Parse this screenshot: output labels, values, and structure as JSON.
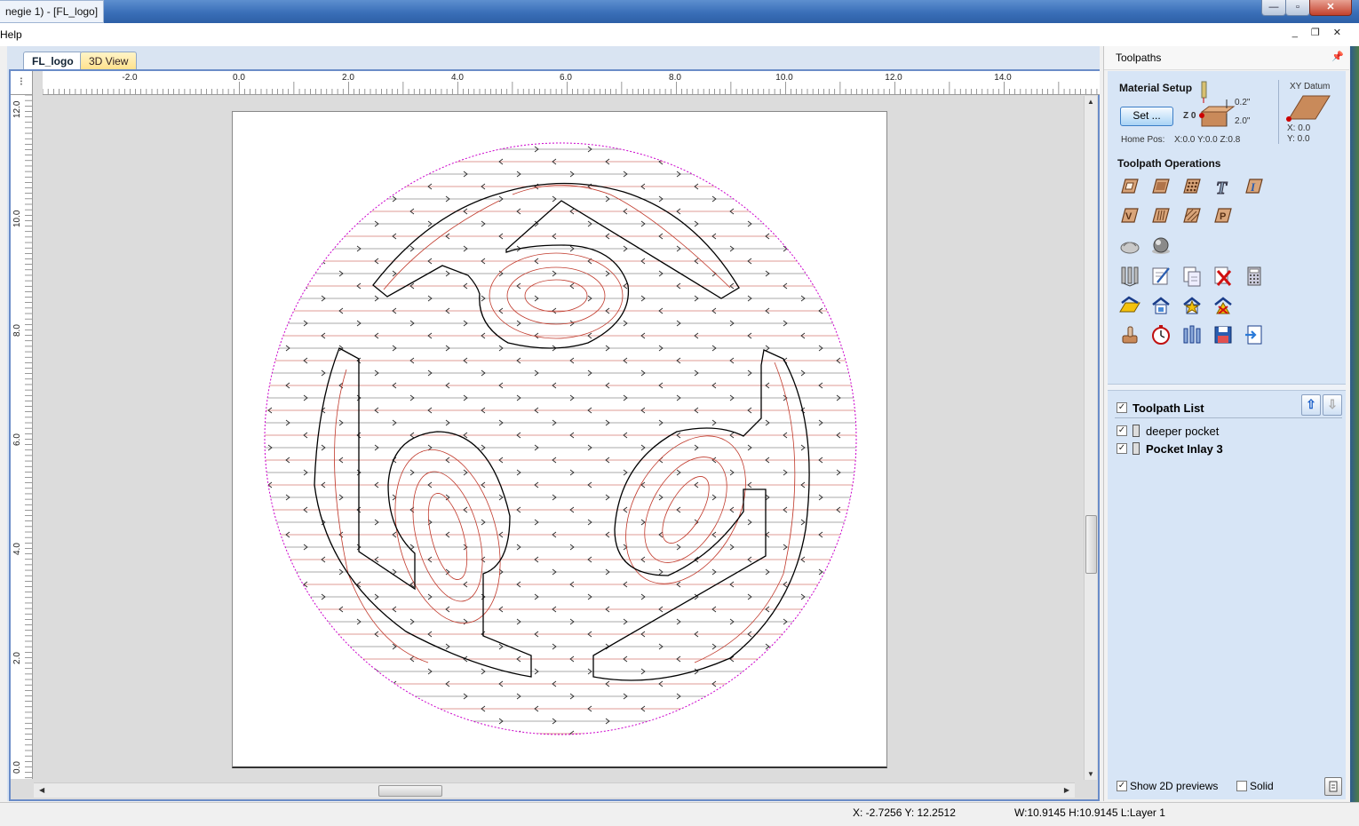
{
  "window": {
    "title": "negie 1) - [FL_logo]",
    "buttons": [
      "—",
      "▫",
      "✕"
    ]
  },
  "menu": {
    "items": [
      "Help"
    ],
    "mdi_controls": "_ ❐ ✕"
  },
  "tabs": [
    {
      "label": "FL_logo",
      "active": true
    },
    {
      "label": "3D View",
      "active": false
    }
  ],
  "ruler": {
    "corner_glyph": "⁝",
    "h_labels": [
      "-2.0",
      "0.0",
      "2.0",
      "4.0",
      "6.0",
      "8.0",
      "10.0",
      "12.0",
      "14.0"
    ],
    "v_labels": [
      "12.0",
      "10.0",
      "8.0",
      "6.0",
      "4.0",
      "2.0",
      "0.0"
    ]
  },
  "panel": {
    "title": "Toolpaths",
    "material_setup": {
      "title": "Material Setup",
      "set_button": "Set ...",
      "z_label": "Z 0",
      "top_offset": "0.2\"",
      "thickness": "2.0\"",
      "home_pos_label": "Home Pos:",
      "home_pos_value": "X:0.0 Y:0.0 Z:0.8"
    },
    "xy_datum": {
      "title": "XY Datum",
      "x": "X: 0.0",
      "y": "Y: 0.0"
    },
    "toolpath_operations": {
      "title": "Toolpath Operations"
    },
    "toolpath_list": {
      "title": "Toolpath List",
      "items": [
        {
          "label": "deeper pocket",
          "checked": true,
          "bold": false
        },
        {
          "label": "Pocket Inlay 3",
          "checked": true,
          "bold": true
        }
      ]
    },
    "options": {
      "show_2d_previews": "Show 2D previews",
      "solid": "Solid"
    }
  },
  "status": {
    "cursor": "X: -2.7256 Y: 12.2512",
    "size": "W:10.9145   H:10.9145  L:Layer 1"
  },
  "colors": {
    "accent_frame": "#6a8cc8",
    "toolpath_red": "#c0392b",
    "boundary_magenta": "#cc00cc",
    "vector_black": "#000000",
    "panel_bg": "#d7e5f6"
  }
}
